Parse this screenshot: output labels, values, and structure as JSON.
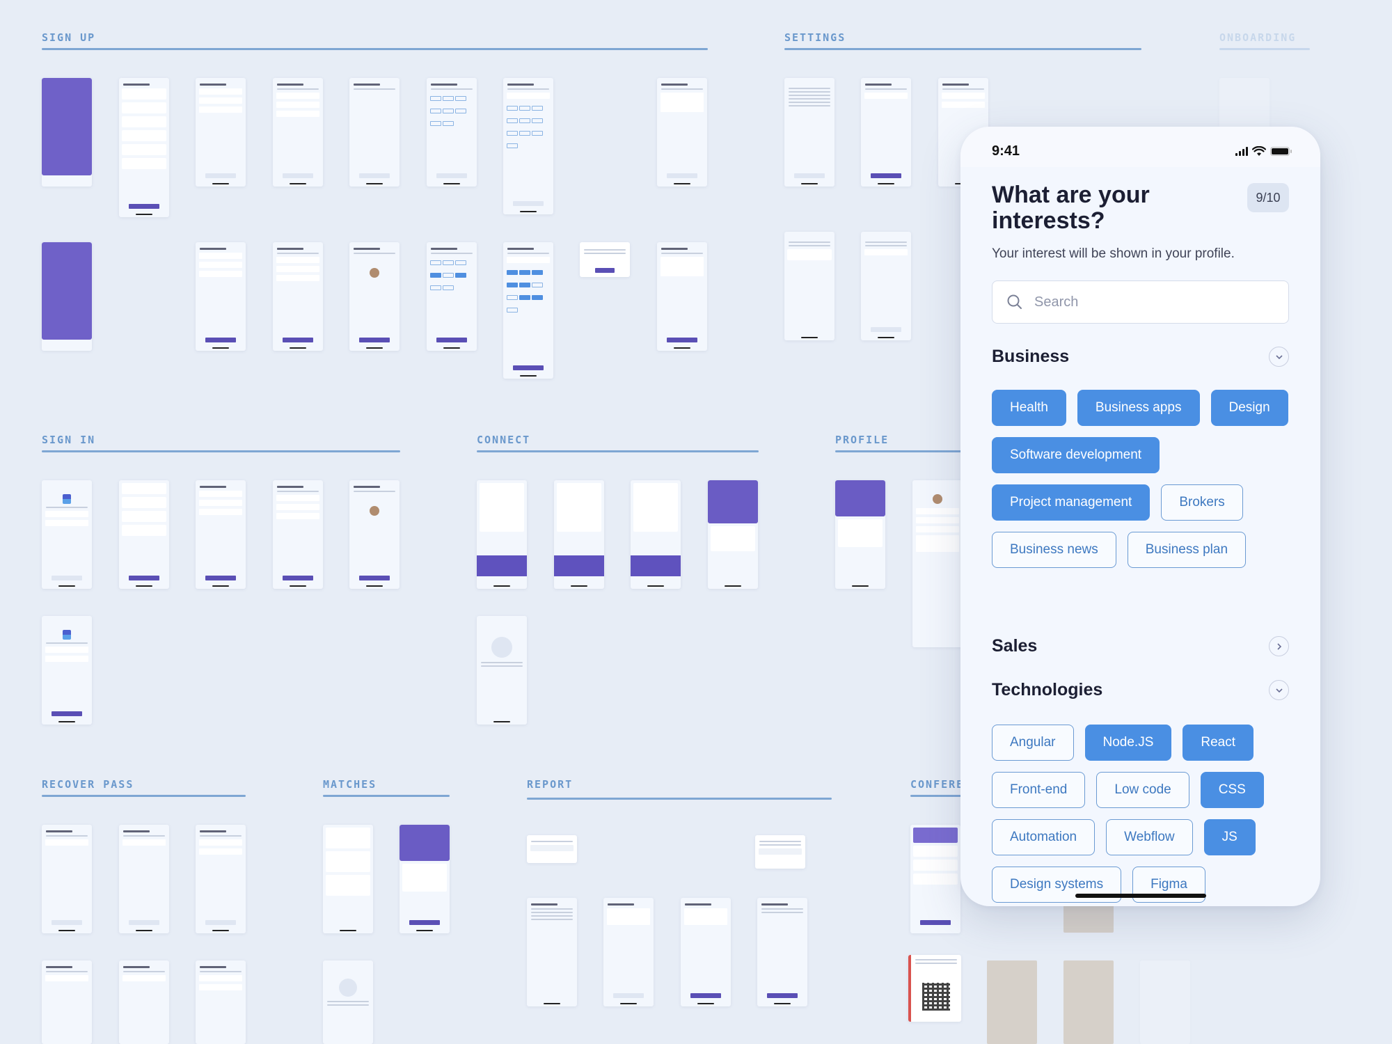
{
  "sections": [
    {
      "id": "sign-up",
      "title": "SIGN UP"
    },
    {
      "id": "settings",
      "title": "SETTINGS"
    },
    {
      "id": "onboarding",
      "title": "ONBOARDING"
    },
    {
      "id": "sign-in",
      "title": "SIGN IN"
    },
    {
      "id": "connect",
      "title": "CONNECT"
    },
    {
      "id": "profile",
      "title": "PROFILE"
    },
    {
      "id": "recover-pass",
      "title": "RECOVER PASS"
    },
    {
      "id": "matches",
      "title": "MATCHES"
    },
    {
      "id": "report",
      "title": "REPORT"
    },
    {
      "id": "conference",
      "title": "CONFERENCE"
    }
  ],
  "phone": {
    "status_bar": {
      "time": "9:41",
      "signal_icon": "cellular-signal-icon",
      "wifi_icon": "wifi-icon",
      "battery_icon": "battery-icon"
    },
    "title": "What are your interests?",
    "step": "9/10",
    "subtitle": "Your interest will be shown in your profile.",
    "search": {
      "placeholder": "Search",
      "value": "",
      "icon": "search-icon"
    },
    "categories": [
      {
        "name": "Business",
        "expanded": true,
        "toggle_icon": "chevron-down-icon",
        "chips": [
          {
            "label": "Health",
            "selected": true
          },
          {
            "label": "Business apps",
            "selected": true
          },
          {
            "label": "Design",
            "selected": true
          },
          {
            "label": "Software development",
            "selected": true
          },
          {
            "label": "Project management",
            "selected": true
          },
          {
            "label": "Brokers",
            "selected": false
          },
          {
            "label": "Business news",
            "selected": false
          },
          {
            "label": "Business plan",
            "selected": false
          }
        ]
      },
      {
        "name": "Sales",
        "expanded": false,
        "toggle_icon": "chevron-right-icon",
        "chips": []
      },
      {
        "name": "Technologies",
        "expanded": true,
        "toggle_icon": "chevron-down-icon",
        "chips": [
          {
            "label": "Angular",
            "selected": false
          },
          {
            "label": "Node.JS",
            "selected": true
          },
          {
            "label": "React",
            "selected": true
          },
          {
            "label": "Front-end",
            "selected": false
          },
          {
            "label": "Low code",
            "selected": false
          },
          {
            "label": "CSS",
            "selected": true
          },
          {
            "label": "Automation",
            "selected": false
          },
          {
            "label": "Webflow",
            "selected": false
          },
          {
            "label": "JS",
            "selected": true
          },
          {
            "label": "Design systems",
            "selected": false
          },
          {
            "label": "Figma",
            "selected": false
          }
        ]
      }
    ]
  },
  "colors": {
    "background": "#e7edf6",
    "section_title": "#6a98cc",
    "chip_selected": "#4a8fe3",
    "chip_outline": "#6a9ad3",
    "brand_purple": "#5a4fb5"
  }
}
